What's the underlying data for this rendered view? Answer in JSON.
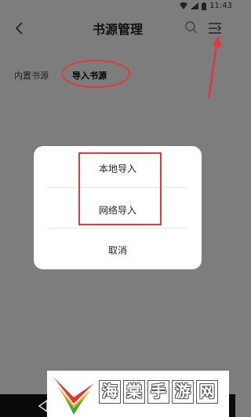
{
  "status_bar": {
    "time": "11:43"
  },
  "app_bar": {
    "title": "书源管理"
  },
  "tabs": [
    {
      "label": "内置书源"
    },
    {
      "label": "导入书源"
    }
  ],
  "dialog": {
    "options": [
      {
        "label": "本地导入"
      },
      {
        "label": "网络导入"
      }
    ],
    "cancel_label": "取消"
  },
  "watermark": {
    "chars": [
      "海",
      "棠",
      "手",
      "游",
      "网"
    ]
  },
  "colors": {
    "annotation": "#e0393e",
    "overlay": "#7d7d7d",
    "dialog": "#ffffff"
  }
}
